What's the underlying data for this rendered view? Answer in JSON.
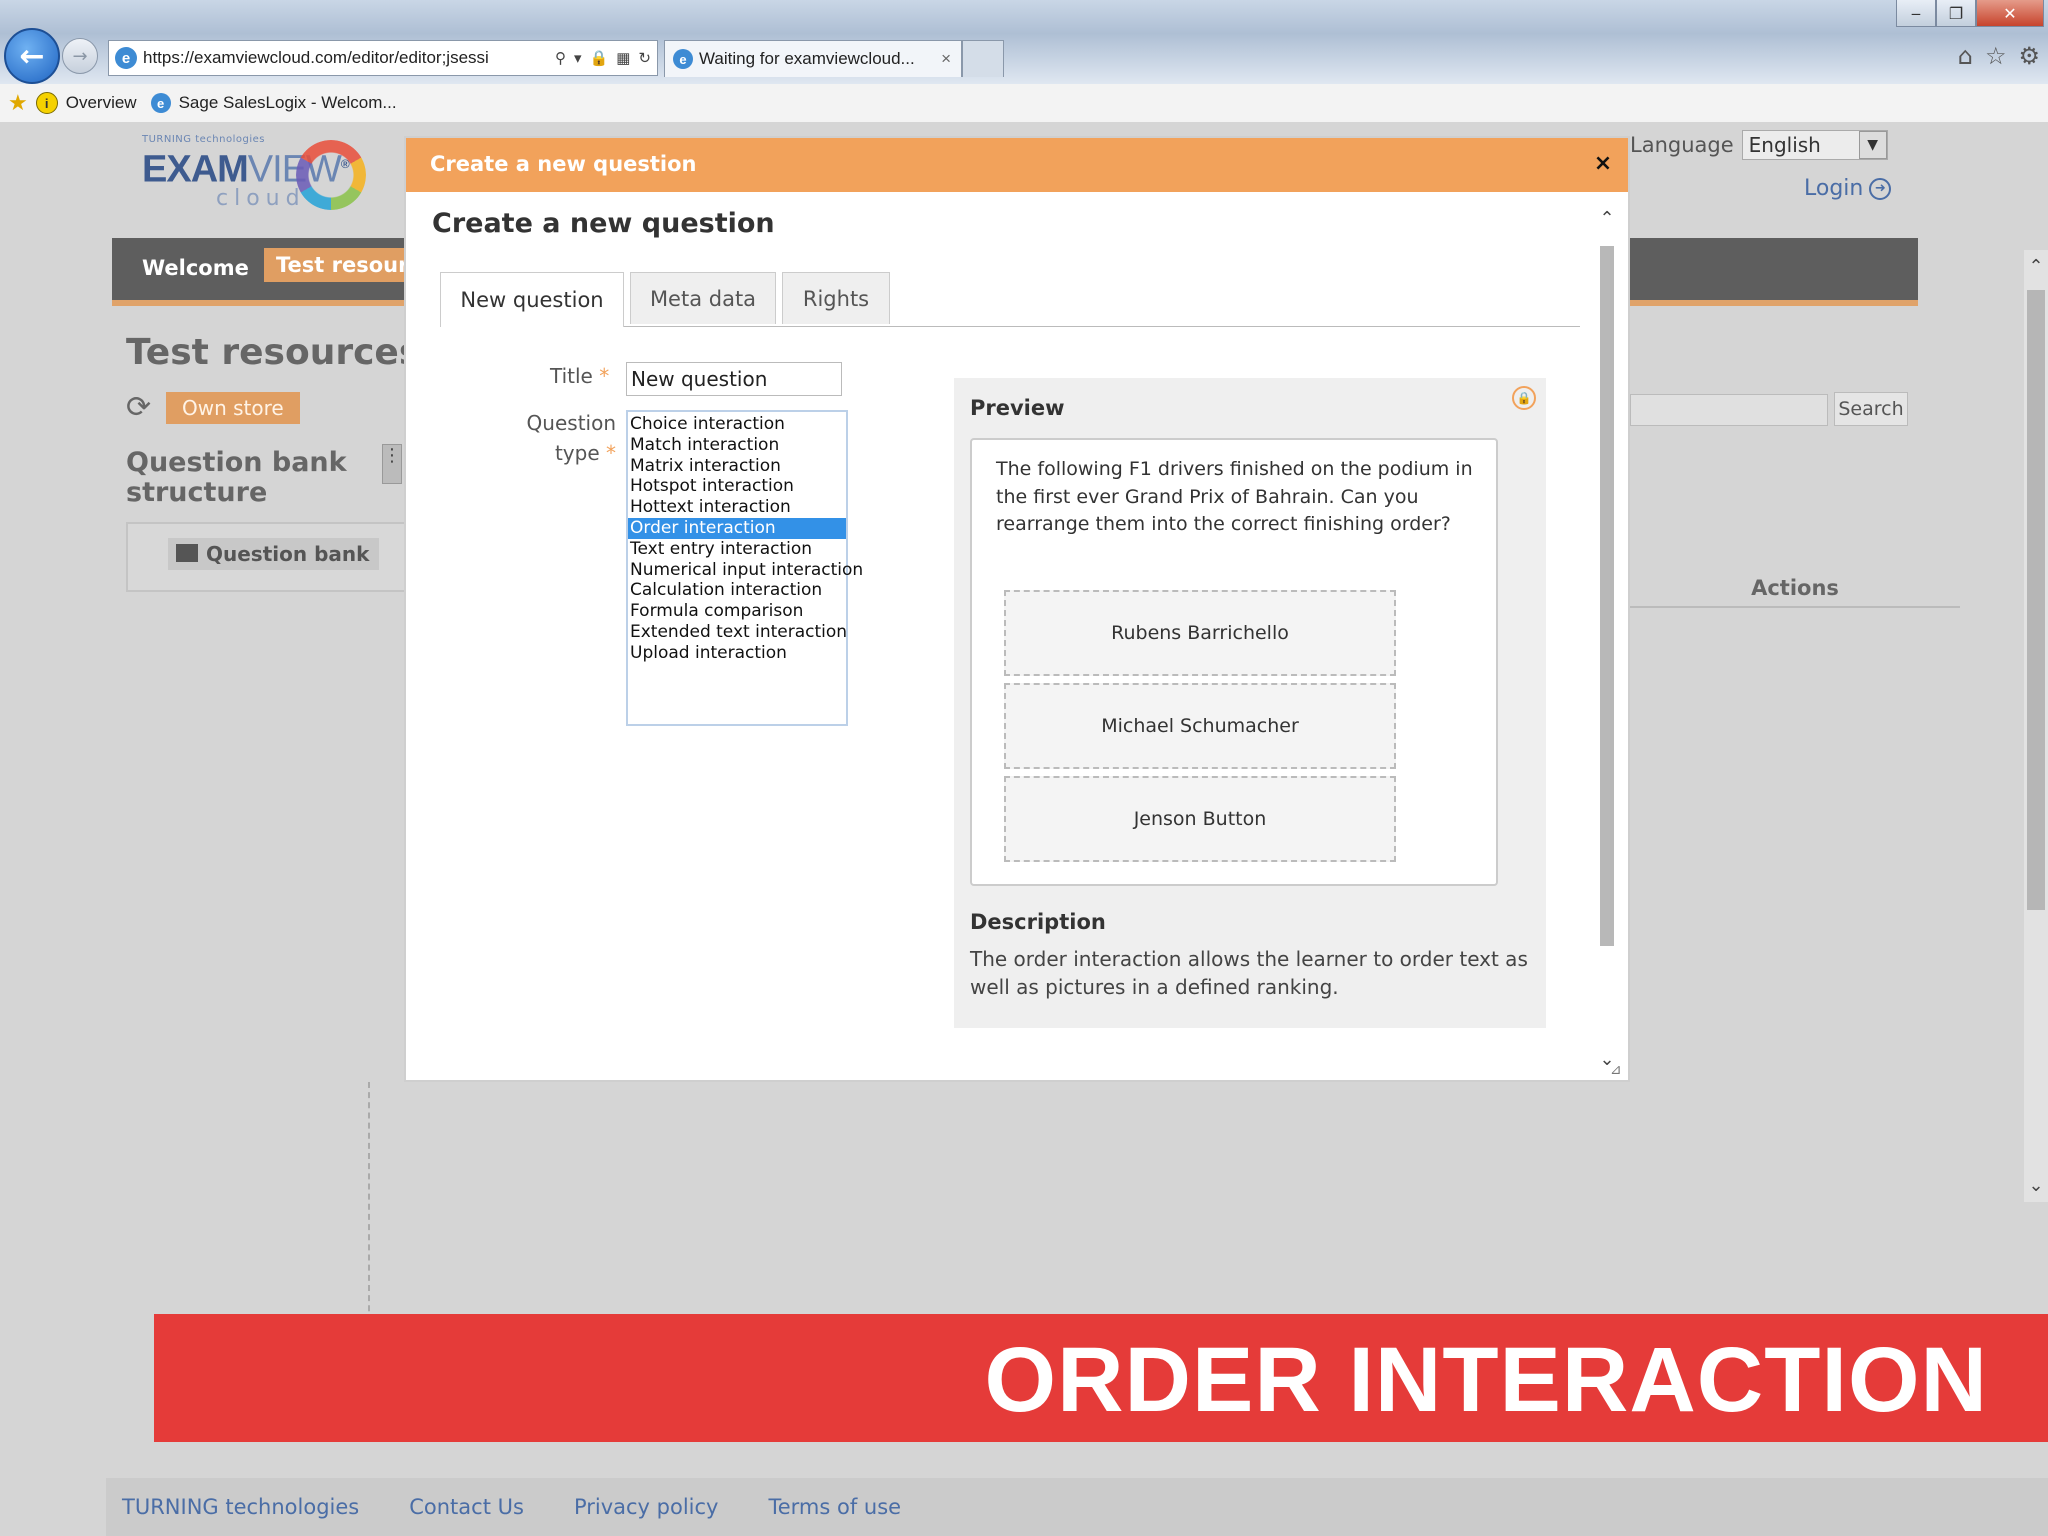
{
  "browser": {
    "url": "https://examviewcloud.com/editor/editor;jsessi",
    "tab_title": "Waiting for examviewcloud...",
    "tab_close": "×",
    "favorites": [
      "Overview",
      "Sage SalesLogix - Welcom..."
    ],
    "window_buttons": [
      "‒",
      "❐",
      "✕"
    ]
  },
  "site": {
    "logo": {
      "top": "TURNING technologies",
      "word_bold": "EXAM",
      "word_light": "VIEW",
      "mark": "®",
      "cloud": "cloud"
    },
    "language_label": "Language",
    "language_value": "English",
    "login_label": "Login",
    "nav": {
      "welcome": "Welcome",
      "test_resources": "Test resourc"
    },
    "page_title": "Test resources",
    "own_store": "Own store",
    "qb_title": "Question bank structure",
    "qb_node": "Question bank",
    "search_button": "Search",
    "actions_header": "Actions"
  },
  "modal": {
    "titlebar": "Create a new question",
    "close": "×",
    "heading": "Create a new question",
    "tabs": [
      "New question",
      "Meta data",
      "Rights"
    ],
    "title_label": "Title",
    "required_mark": "*",
    "title_value": "New question",
    "question_type_label_1": "Question",
    "question_type_label_2": "type",
    "question_types": [
      "Choice interaction",
      "Match interaction",
      "Matrix interaction",
      "Hotspot interaction",
      "Hottext interaction",
      "Order interaction",
      "Text entry interaction",
      "Numerical input interaction",
      "Calculation interaction",
      "Formula comparison",
      "Extended text interaction",
      "Upload interaction"
    ],
    "selected_type": "Order interaction",
    "preview": {
      "label": "Preview",
      "prompt": "The following F1 drivers finished on the podium in the first ever Grand Prix of Bahrain. Can you rearrange them into the correct finishing order?",
      "items": [
        "Rubens Barrichello",
        "Michael Schumacher",
        "Jenson Button"
      ],
      "description_label": "Description",
      "description": "The order interaction allows the learner to order text as well as pictures in a defined ranking."
    }
  },
  "banner": {
    "text": "ORDER INTERACTION",
    "color": "#e53b39"
  },
  "footer": {
    "links": [
      "TURNING technologies",
      "Contact Us",
      "Privacy policy",
      "Terms of use"
    ]
  },
  "colors": {
    "accent": "#f2a25b",
    "selection": "#3391e7",
    "link": "#4a6da6"
  }
}
